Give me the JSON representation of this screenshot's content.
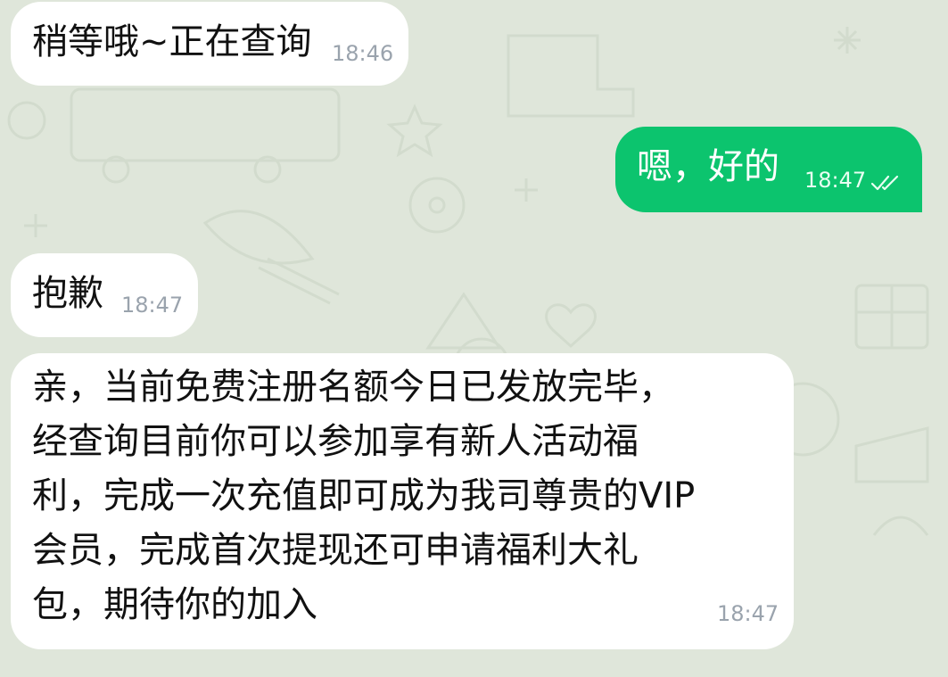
{
  "messages": [
    {
      "direction": "incoming",
      "text": "稍等哦~正在查询",
      "time": "18:46"
    },
    {
      "direction": "outgoing",
      "text": "嗯，好的",
      "time": "18:47",
      "status_icon": "double-check-icon"
    },
    {
      "direction": "incoming",
      "text": "抱歉",
      "time": "18:47"
    },
    {
      "direction": "incoming",
      "lines": [
        "亲，当前免费注册名额今日已发放完毕，",
        "经查询目前你可以参加享有新人活动福",
        "利，完成一次充值即可成为我司尊贵的VIP",
        "会员，完成首次提现还可申请福利大礼",
        "包，期待你的加入"
      ],
      "time": "18:47"
    }
  ],
  "colors": {
    "background": "#dfe6da",
    "incoming_bubble": "#ffffff",
    "outgoing_bubble": "#0cc46e",
    "timestamp_incoming": "#9aa3ad"
  }
}
